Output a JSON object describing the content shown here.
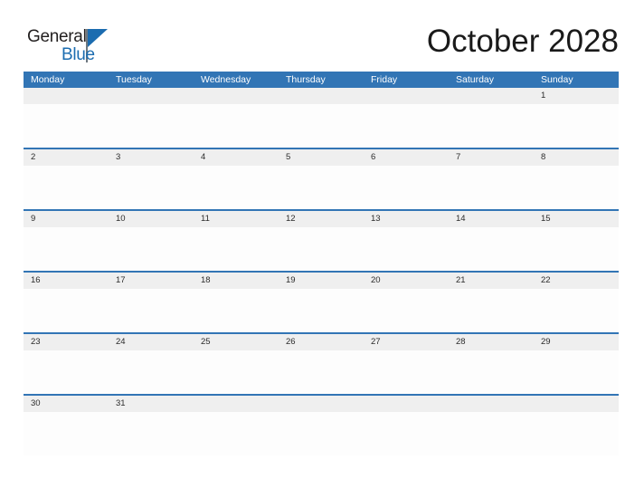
{
  "brand": {
    "name_top": "General",
    "name_bottom": "Blue",
    "triangle_color": "#1b6cb0",
    "text_color": "#221f1f",
    "accent_color": "#1b6cb0"
  },
  "header": {
    "title": "October 2028"
  },
  "calendar": {
    "month": "October",
    "year": "2028",
    "header_color": "#3275b5",
    "band_color": "#efefef",
    "separator_color": "#3275b5",
    "day_headers": [
      "Monday",
      "Tuesday",
      "Wednesday",
      "Thursday",
      "Friday",
      "Saturday",
      "Sunday"
    ],
    "weeks": [
      [
        "",
        "",
        "",
        "",
        "",
        "",
        "1"
      ],
      [
        "2",
        "3",
        "4",
        "5",
        "6",
        "7",
        "8"
      ],
      [
        "9",
        "10",
        "11",
        "12",
        "13",
        "14",
        "15"
      ],
      [
        "16",
        "17",
        "18",
        "19",
        "20",
        "21",
        "22"
      ],
      [
        "23",
        "24",
        "25",
        "26",
        "27",
        "28",
        "29"
      ],
      [
        "30",
        "31",
        "",
        "",
        "",
        "",
        ""
      ]
    ]
  }
}
